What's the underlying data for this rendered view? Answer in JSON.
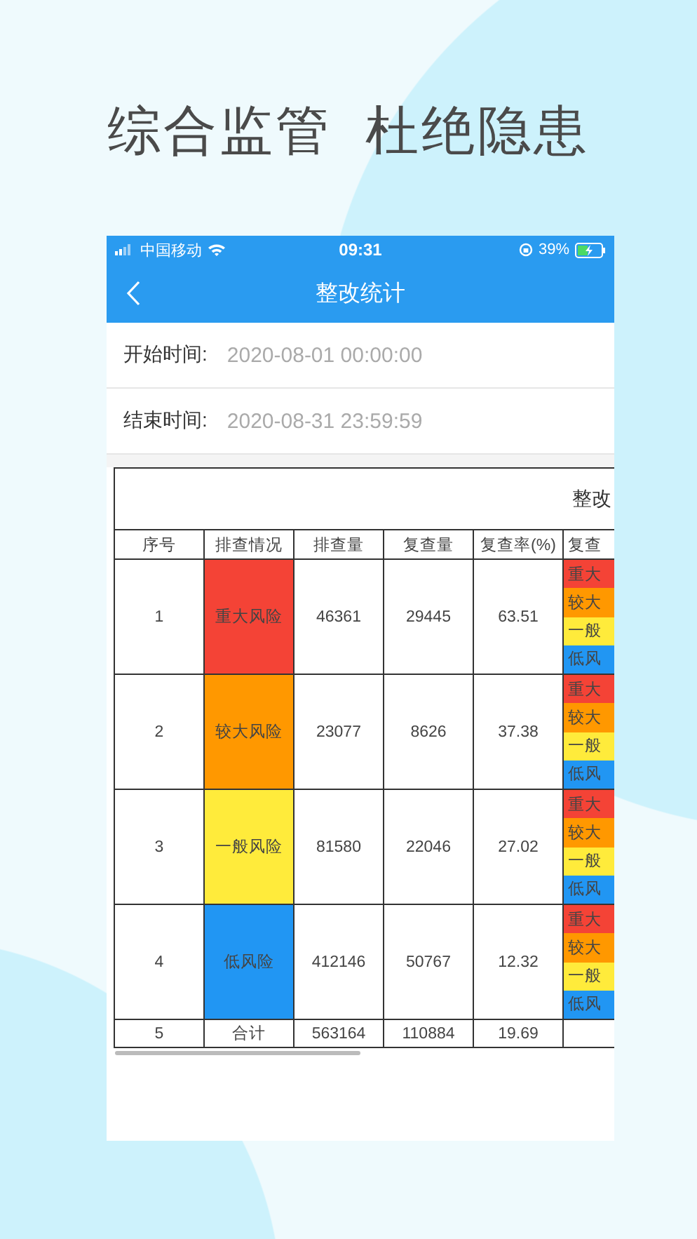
{
  "headline": [
    "综合监管",
    "杜绝隐患"
  ],
  "status_bar": {
    "carrier": "中国移动",
    "time": "09:31",
    "battery": "39%"
  },
  "nav": {
    "title": "整改统计"
  },
  "filters": [
    {
      "label": "开始时间:",
      "value": "2020-08-01 00:00:00"
    },
    {
      "label": "结束时间:",
      "value": "2020-08-31 23:59:59"
    }
  ],
  "table": {
    "title": "整改",
    "columns": [
      "序号",
      "排查情况",
      "排查量",
      "复查量",
      "复查率(%)",
      "复查"
    ],
    "rows": [
      {
        "no": "1",
        "risk": {
          "label": "重大风险",
          "color": "#f44336"
        },
        "checked": "46361",
        "rechecked": "29445",
        "rate": "63.51",
        "breakdown": [
          {
            "label": "重大",
            "color": "#f44336"
          },
          {
            "label": "较大",
            "color": "#ff9800"
          },
          {
            "label": "一般",
            "color": "#ffeb3b"
          },
          {
            "label": "低风",
            "color": "#2196f3"
          }
        ]
      },
      {
        "no": "2",
        "risk": {
          "label": "较大风险",
          "color": "#ff9800"
        },
        "checked": "23077",
        "rechecked": "8626",
        "rate": "37.38",
        "breakdown": [
          {
            "label": "重大",
            "color": "#f44336"
          },
          {
            "label": "较大",
            "color": "#ff9800"
          },
          {
            "label": "一般",
            "color": "#ffeb3b"
          },
          {
            "label": "低风",
            "color": "#2196f3"
          }
        ]
      },
      {
        "no": "3",
        "risk": {
          "label": "一般风险",
          "color": "#ffeb3b"
        },
        "checked": "81580",
        "rechecked": "22046",
        "rate": "27.02",
        "breakdown": [
          {
            "label": "重大",
            "color": "#f44336"
          },
          {
            "label": "较大",
            "color": "#ff9800"
          },
          {
            "label": "一般",
            "color": "#ffeb3b"
          },
          {
            "label": "低风",
            "color": "#2196f3"
          }
        ]
      },
      {
        "no": "4",
        "risk": {
          "label": "低风险",
          "color": "#2196f3"
        },
        "checked": "412146",
        "rechecked": "50767",
        "rate": "12.32",
        "breakdown": [
          {
            "label": "重大",
            "color": "#f44336"
          },
          {
            "label": "较大",
            "color": "#ff9800"
          },
          {
            "label": "一般",
            "color": "#ffeb3b"
          },
          {
            "label": "低风",
            "color": "#2196f3"
          }
        ]
      }
    ],
    "total": {
      "no": "5",
      "label": "合计",
      "checked": "563164",
      "rechecked": "110884",
      "rate": "19.69"
    }
  }
}
